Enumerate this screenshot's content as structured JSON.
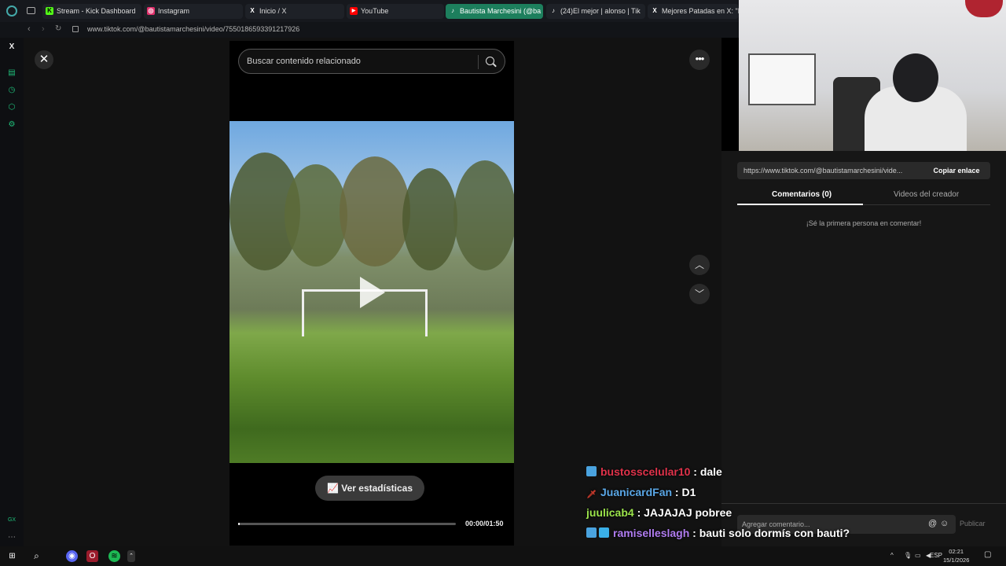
{
  "browser": {
    "tabs": [
      {
        "label": "Stream - Kick Dashboard",
        "icon": "K",
        "color": "#53fc18"
      },
      {
        "label": "Instagram",
        "icon": "◎",
        "color": "#e1306c"
      },
      {
        "label": "Inicio / X",
        "icon": "X",
        "color": "#ffffff"
      },
      {
        "label": "YouTube",
        "icon": "▶",
        "color": "#ff0000"
      },
      {
        "label": "Bautista Marchesini (@ba",
        "icon": "♪",
        "color": "#ffffff"
      },
      {
        "label": "(24)El mejor | alonso | Tik",
        "icon": "♪",
        "color": "#ffffff"
      },
      {
        "label": "Mejores Patadas en X: \"E",
        "icon": "X",
        "color": "#ffffff"
      }
    ],
    "url": "www.tiktok.com/@bautistamarchesini/video/7550186593391217926",
    "sidebar_label": "GX"
  },
  "tiktok": {
    "search_placeholder": "Buscar contenido relacionado",
    "stats_button": "Ver estadísticas",
    "time": "00:00/01:50",
    "progress": 0.005,
    "share_url": "https://www.tiktok.com/@bautistamarchesini/vide...",
    "copy_link": "Copiar enlace",
    "tab_comments": "Comentarios (0)",
    "tab_creator": "Videos del creador",
    "empty_comments": "¡Sé la primera persona en comentar!",
    "comment_placeholder": "Agregar comentario...",
    "publish": "Publicar"
  },
  "chat": [
    {
      "user": "bustosscelular10",
      "message": ": dale",
      "color": "#e0324a",
      "badge": "#4aa3df"
    },
    {
      "user": "JuanicardFan",
      "message": ": D1",
      "color": "#5aa7e6",
      "badge": "#c0392b"
    },
    {
      "user": "juulicab4",
      "message": ": JAJAJAJ pobree",
      "color": "#9be34b",
      "badge": ""
    },
    {
      "user": "ramiselleslagh",
      "message": ": bauti solo dormís con bauti?",
      "color": "#b07cf0",
      "badge": "#4aa3df"
    }
  ],
  "taskbar": {
    "lang": "ESP",
    "time": "02:21",
    "date": "15/1/2026"
  }
}
